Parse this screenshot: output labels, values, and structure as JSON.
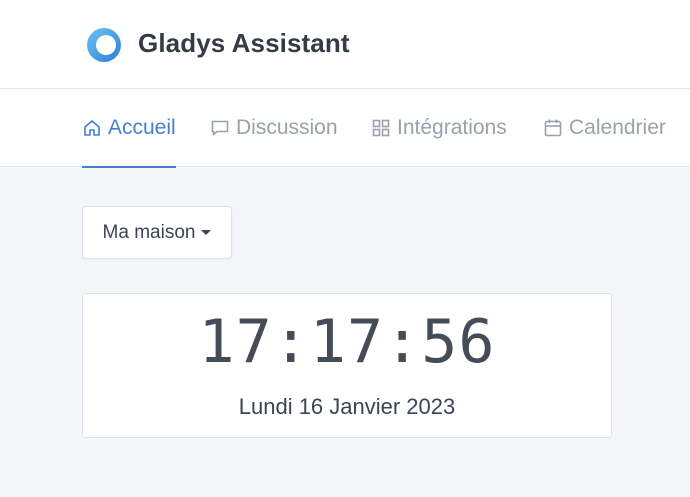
{
  "app": {
    "title": "Gladys Assistant",
    "logo_icon": "gladys-ring-logo-icon"
  },
  "nav": {
    "items": [
      {
        "label": "Accueil",
        "icon": "home-icon",
        "active": true
      },
      {
        "label": "Discussion",
        "icon": "chat-icon",
        "active": false
      },
      {
        "label": "Intégrations",
        "icon": "grid-icon",
        "active": false
      },
      {
        "label": "Calendrier",
        "icon": "calendar-icon",
        "active": false
      }
    ]
  },
  "house_selector": {
    "label": "Ma maison"
  },
  "clock_widget": {
    "time": "17:17:56",
    "date": "Lundi 16 Janvier 2023"
  },
  "colors": {
    "accent": "#467fcf",
    "nav_inactive": "#9aa0ac",
    "background": "#f4f6fa"
  }
}
